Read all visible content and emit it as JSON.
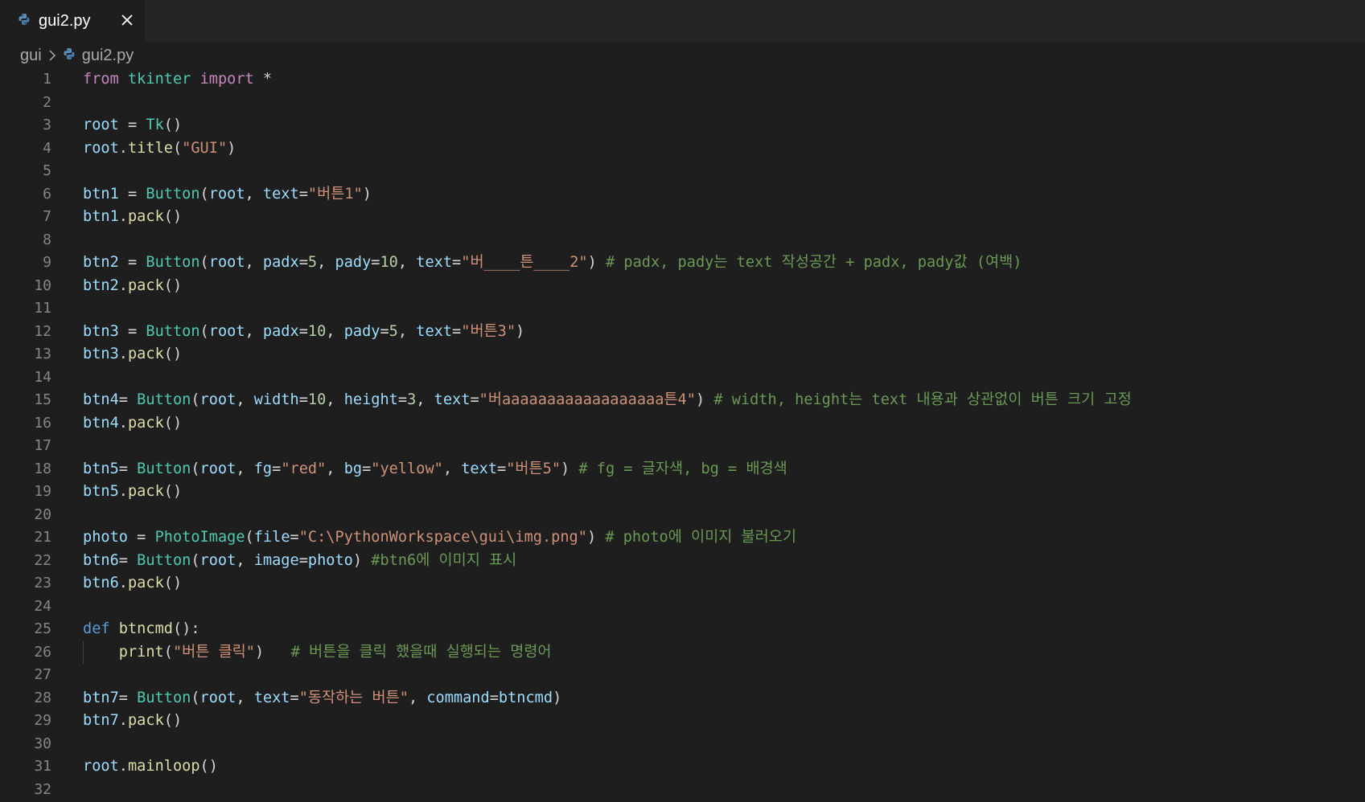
{
  "tab": {
    "label": "gui2.py",
    "icon": "python-file-icon",
    "close_icon": "close-icon"
  },
  "breadcrumb": {
    "folder": "gui",
    "file": "gui2.py"
  },
  "colors": {
    "editor_bg": "#1e1e1e",
    "tabbar_bg": "#252526",
    "keyword": "#c586c0",
    "def_keyword": "#569cd6",
    "class": "#4ec9b0",
    "variable": "#9cdcfe",
    "function": "#dcdcaa",
    "string": "#ce9178",
    "number": "#b5cea8",
    "comment": "#6a9955",
    "line_number": "#858585"
  },
  "code_lines": [
    [
      [
        "kw",
        "from"
      ],
      [
        "op",
        " "
      ],
      [
        "mod",
        "tkinter"
      ],
      [
        "op",
        " "
      ],
      [
        "kw",
        "import"
      ],
      [
        "op",
        " *"
      ]
    ],
    [],
    [
      [
        "var",
        "root"
      ],
      [
        "op",
        " = "
      ],
      [
        "cls",
        "Tk"
      ],
      [
        "op",
        "()"
      ]
    ],
    [
      [
        "var",
        "root"
      ],
      [
        "op",
        "."
      ],
      [
        "fn",
        "title"
      ],
      [
        "op",
        "("
      ],
      [
        "str",
        "\"GUI\""
      ],
      [
        "op",
        ")"
      ]
    ],
    [],
    [
      [
        "var",
        "btn1"
      ],
      [
        "op",
        " = "
      ],
      [
        "cls",
        "Button"
      ],
      [
        "op",
        "("
      ],
      [
        "var",
        "root"
      ],
      [
        "op",
        ", "
      ],
      [
        "var",
        "text"
      ],
      [
        "op",
        "="
      ],
      [
        "str",
        "\"버튼1\""
      ],
      [
        "op",
        ")"
      ]
    ],
    [
      [
        "var",
        "btn1"
      ],
      [
        "op",
        "."
      ],
      [
        "fn",
        "pack"
      ],
      [
        "op",
        "()"
      ]
    ],
    [],
    [
      [
        "var",
        "btn2"
      ],
      [
        "op",
        " = "
      ],
      [
        "cls",
        "Button"
      ],
      [
        "op",
        "("
      ],
      [
        "var",
        "root"
      ],
      [
        "op",
        ", "
      ],
      [
        "var",
        "padx"
      ],
      [
        "op",
        "="
      ],
      [
        "num",
        "5"
      ],
      [
        "op",
        ", "
      ],
      [
        "var",
        "pady"
      ],
      [
        "op",
        "="
      ],
      [
        "num",
        "10"
      ],
      [
        "op",
        ", "
      ],
      [
        "var",
        "text"
      ],
      [
        "op",
        "="
      ],
      [
        "str",
        "\"버____튼____2\""
      ],
      [
        "op",
        ") "
      ],
      [
        "cmt",
        "# padx, pady는 text 작성공간 + padx, pady값 (여백)"
      ]
    ],
    [
      [
        "var",
        "btn2"
      ],
      [
        "op",
        "."
      ],
      [
        "fn",
        "pack"
      ],
      [
        "op",
        "()"
      ]
    ],
    [],
    [
      [
        "var",
        "btn3"
      ],
      [
        "op",
        " = "
      ],
      [
        "cls",
        "Button"
      ],
      [
        "op",
        "("
      ],
      [
        "var",
        "root"
      ],
      [
        "op",
        ", "
      ],
      [
        "var",
        "padx"
      ],
      [
        "op",
        "="
      ],
      [
        "num",
        "10"
      ],
      [
        "op",
        ", "
      ],
      [
        "var",
        "pady"
      ],
      [
        "op",
        "="
      ],
      [
        "num",
        "5"
      ],
      [
        "op",
        ", "
      ],
      [
        "var",
        "text"
      ],
      [
        "op",
        "="
      ],
      [
        "str",
        "\"버튼3\""
      ],
      [
        "op",
        ")"
      ]
    ],
    [
      [
        "var",
        "btn3"
      ],
      [
        "op",
        "."
      ],
      [
        "fn",
        "pack"
      ],
      [
        "op",
        "()"
      ]
    ],
    [],
    [
      [
        "var",
        "btn4"
      ],
      [
        "op",
        "= "
      ],
      [
        "cls",
        "Button"
      ],
      [
        "op",
        "("
      ],
      [
        "var",
        "root"
      ],
      [
        "op",
        ", "
      ],
      [
        "var",
        "width"
      ],
      [
        "op",
        "="
      ],
      [
        "num",
        "10"
      ],
      [
        "op",
        ", "
      ],
      [
        "var",
        "height"
      ],
      [
        "op",
        "="
      ],
      [
        "num",
        "3"
      ],
      [
        "op",
        ", "
      ],
      [
        "var",
        "text"
      ],
      [
        "op",
        "="
      ],
      [
        "str",
        "\"버aaaaaaaaaaaaaaaaaa튼4\""
      ],
      [
        "op",
        ") "
      ],
      [
        "cmt",
        "# width, height는 text 내용과 상관없이 버튼 크기 고정"
      ]
    ],
    [
      [
        "var",
        "btn4"
      ],
      [
        "op",
        "."
      ],
      [
        "fn",
        "pack"
      ],
      [
        "op",
        "()"
      ]
    ],
    [],
    [
      [
        "var",
        "btn5"
      ],
      [
        "op",
        "= "
      ],
      [
        "cls",
        "Button"
      ],
      [
        "op",
        "("
      ],
      [
        "var",
        "root"
      ],
      [
        "op",
        ", "
      ],
      [
        "var",
        "fg"
      ],
      [
        "op",
        "="
      ],
      [
        "str",
        "\"red\""
      ],
      [
        "op",
        ", "
      ],
      [
        "var",
        "bg"
      ],
      [
        "op",
        "="
      ],
      [
        "str",
        "\"yellow\""
      ],
      [
        "op",
        ", "
      ],
      [
        "var",
        "text"
      ],
      [
        "op",
        "="
      ],
      [
        "str",
        "\"버튼5\""
      ],
      [
        "op",
        ") "
      ],
      [
        "cmt",
        "# fg = 글자색, bg = 배경색"
      ]
    ],
    [
      [
        "var",
        "btn5"
      ],
      [
        "op",
        "."
      ],
      [
        "fn",
        "pack"
      ],
      [
        "op",
        "()"
      ]
    ],
    [],
    [
      [
        "var",
        "photo"
      ],
      [
        "op",
        " = "
      ],
      [
        "cls",
        "PhotoImage"
      ],
      [
        "op",
        "("
      ],
      [
        "var",
        "file"
      ],
      [
        "op",
        "="
      ],
      [
        "str",
        "\"C:\\PythonWorkspace\\gui\\img.png\""
      ],
      [
        "op",
        ") "
      ],
      [
        "cmt",
        "# photo에 이미지 불러오기"
      ]
    ],
    [
      [
        "var",
        "btn6"
      ],
      [
        "op",
        "= "
      ],
      [
        "cls",
        "Button"
      ],
      [
        "op",
        "("
      ],
      [
        "var",
        "root"
      ],
      [
        "op",
        ", "
      ],
      [
        "var",
        "image"
      ],
      [
        "op",
        "="
      ],
      [
        "var",
        "photo"
      ],
      [
        "op",
        ") "
      ],
      [
        "cmt",
        "#btn6에 이미지 표시"
      ]
    ],
    [
      [
        "var",
        "btn6"
      ],
      [
        "op",
        "."
      ],
      [
        "fn",
        "pack"
      ],
      [
        "op",
        "()"
      ]
    ],
    [],
    [
      [
        "kw2",
        "def"
      ],
      [
        "op",
        " "
      ],
      [
        "fn",
        "btncmd"
      ],
      [
        "op",
        "():"
      ]
    ],
    [
      [
        "op",
        "    "
      ],
      [
        "fn",
        "print"
      ],
      [
        "op",
        "("
      ],
      [
        "str",
        "\"버튼 클릭\""
      ],
      [
        "op",
        ")   "
      ],
      [
        "cmt",
        "# 버튼을 클릭 했을때 실행되는 명령어"
      ]
    ],
    [],
    [
      [
        "var",
        "btn7"
      ],
      [
        "op",
        "= "
      ],
      [
        "cls",
        "Button"
      ],
      [
        "op",
        "("
      ],
      [
        "var",
        "root"
      ],
      [
        "op",
        ", "
      ],
      [
        "var",
        "text"
      ],
      [
        "op",
        "="
      ],
      [
        "str",
        "\"동작하는 버튼\""
      ],
      [
        "op",
        ", "
      ],
      [
        "var",
        "command"
      ],
      [
        "op",
        "="
      ],
      [
        "var",
        "btncmd"
      ],
      [
        "op",
        ")"
      ]
    ],
    [
      [
        "var",
        "btn7"
      ],
      [
        "op",
        "."
      ],
      [
        "fn",
        "pack"
      ],
      [
        "op",
        "()"
      ]
    ],
    [],
    [
      [
        "var",
        "root"
      ],
      [
        "op",
        "."
      ],
      [
        "fn",
        "mainloop"
      ],
      [
        "op",
        "()"
      ]
    ],
    []
  ],
  "line_numbers": [
    "1",
    "2",
    "3",
    "4",
    "5",
    "6",
    "7",
    "8",
    "9",
    "10",
    "11",
    "12",
    "13",
    "14",
    "15",
    "16",
    "17",
    "18",
    "19",
    "20",
    "21",
    "22",
    "23",
    "24",
    "25",
    "26",
    "27",
    "28",
    "29",
    "30",
    "31",
    "32"
  ]
}
